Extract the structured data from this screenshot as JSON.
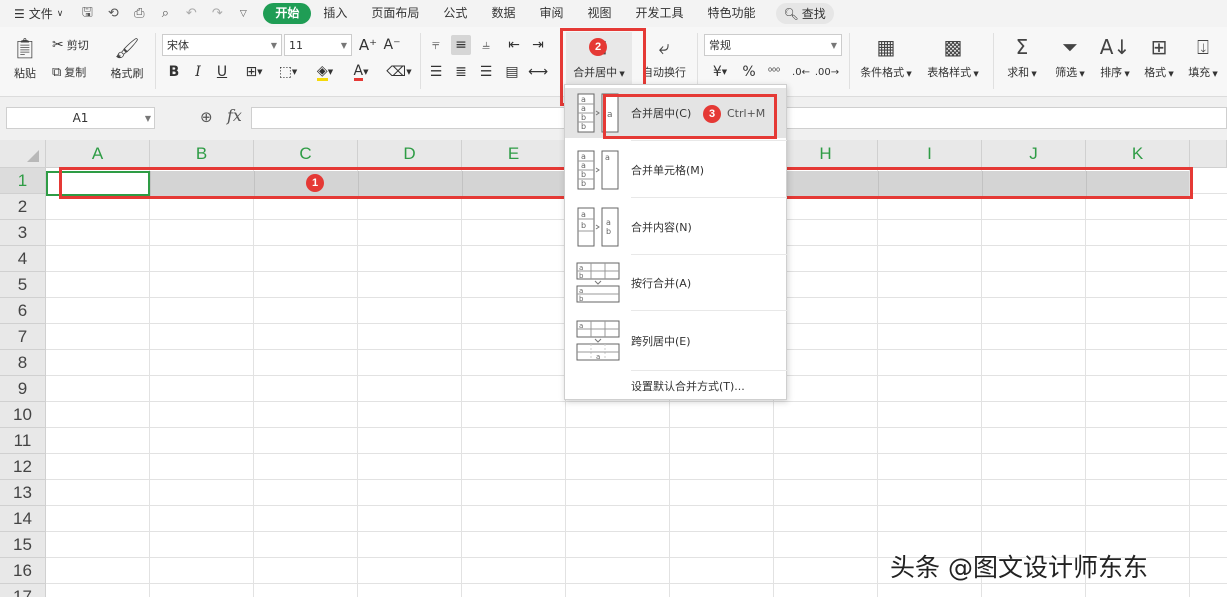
{
  "menubar": {
    "file_label": "文件",
    "tabs": [
      {
        "label": "开始",
        "active": true
      },
      {
        "label": "插入"
      },
      {
        "label": "页面布局"
      },
      {
        "label": "公式"
      },
      {
        "label": "数据"
      },
      {
        "label": "审阅"
      },
      {
        "label": "视图"
      },
      {
        "label": "开发工具"
      },
      {
        "label": "特色功能"
      }
    ],
    "search_label": "查找"
  },
  "ribbon": {
    "paste": "粘贴",
    "cut": "剪切",
    "copy": "复制",
    "format_painter": "格式刷",
    "font_name": "宋体",
    "font_size": "11",
    "merge_center": "合并居中",
    "wrap_text": "自动换行",
    "number_format": "常规",
    "conditional_format": "条件格式",
    "table_style": "表格样式",
    "sum": "求和",
    "filter": "筛选",
    "sort": "排序",
    "format": "格式",
    "fill": "填充"
  },
  "formula_bar": {
    "name_box": "A1",
    "fx_label": "fx",
    "formula": ""
  },
  "grid": {
    "columns": [
      "A",
      "B",
      "C",
      "D",
      "E",
      "F",
      "G",
      "H",
      "I",
      "J",
      "K"
    ],
    "rows": [
      "1",
      "2",
      "3",
      "4",
      "5",
      "6",
      "7",
      "8",
      "9",
      "10",
      "11",
      "12",
      "13",
      "14",
      "15",
      "16",
      "17"
    ]
  },
  "merge_menu": {
    "items": [
      {
        "label": "合并居中(C)",
        "shortcut": "Ctrl+M"
      },
      {
        "label": "合并单元格(M)"
      },
      {
        "label": "合并内容(N)"
      },
      {
        "label": "按行合并(A)"
      },
      {
        "label": "跨列居中(E)"
      }
    ],
    "default_setting": "设置默认合并方式(T)..."
  },
  "annotations": {
    "badges": [
      "1",
      "2",
      "3"
    ],
    "color": "#e53935"
  },
  "colors": {
    "accent": "#1f9d55",
    "header_text": "#2e9c45"
  },
  "watermark": "头条 @图文设计师东东"
}
